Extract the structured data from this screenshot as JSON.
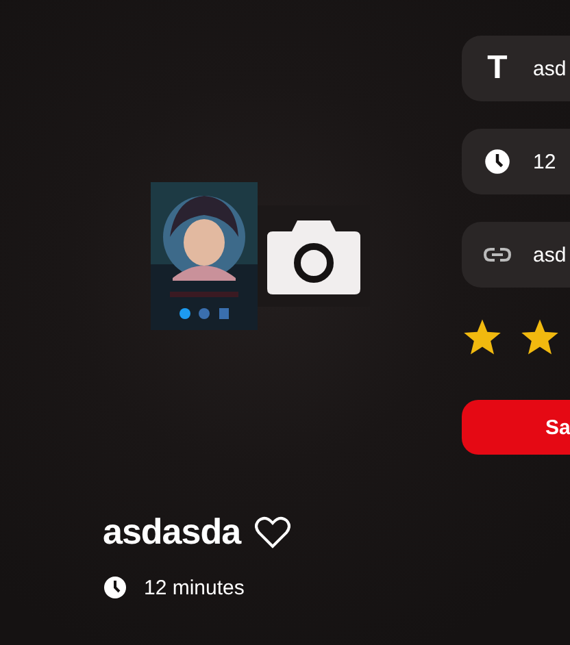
{
  "title": "asdasda",
  "favorite": false,
  "duration": "12 minutes",
  "form": {
    "fields": [
      {
        "kind": "title",
        "icon_text": "T",
        "value": "asd"
      },
      {
        "kind": "duration",
        "value": "12"
      },
      {
        "kind": "link",
        "value": "asd"
      }
    ],
    "save_button": "Sa"
  }
}
